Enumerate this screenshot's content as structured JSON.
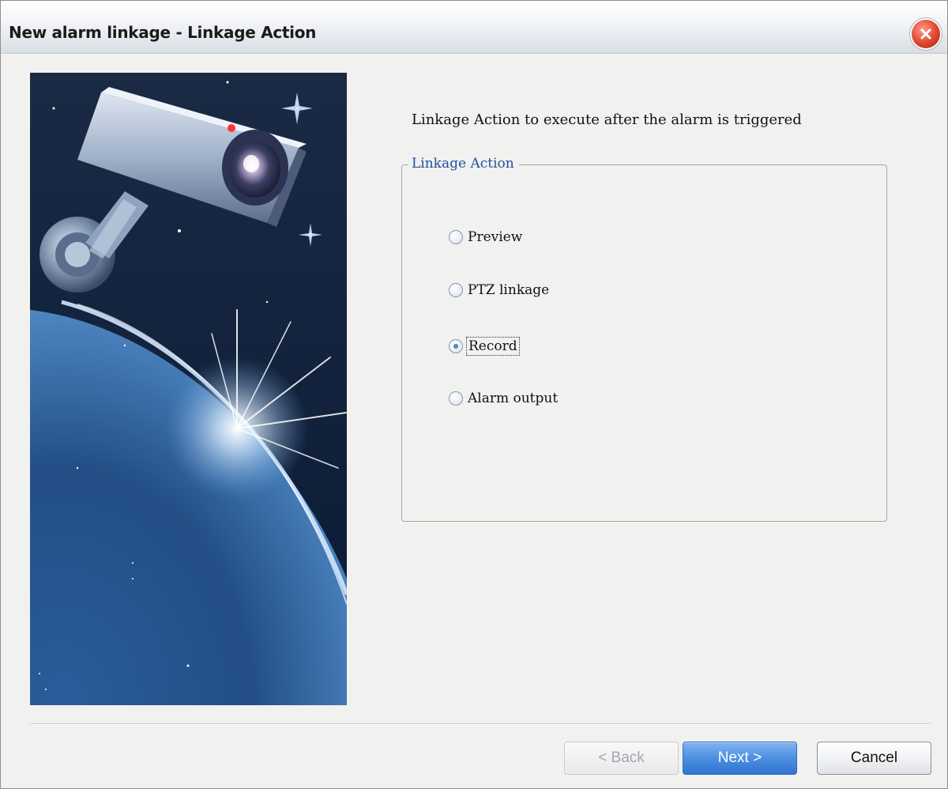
{
  "window": {
    "title": "New alarm linkage - Linkage Action",
    "close_icon": "close-icon"
  },
  "banner": {
    "image": "security-camera-over-planet-illustration"
  },
  "main": {
    "instruction": "Linkage Action to execute after the alarm is triggered",
    "group_label": "Linkage Action",
    "options": [
      {
        "label": "Preview",
        "checked": false
      },
      {
        "label": "PTZ linkage",
        "checked": false
      },
      {
        "label": "Record",
        "checked": true
      },
      {
        "label": "Alarm output",
        "checked": false
      }
    ]
  },
  "buttons": {
    "back": "< Back",
    "next": "Next >",
    "cancel": "Cancel"
  },
  "colors": {
    "accent": "#2f74d2",
    "group_label": "#1f4fa0",
    "close": "#e24b35"
  }
}
